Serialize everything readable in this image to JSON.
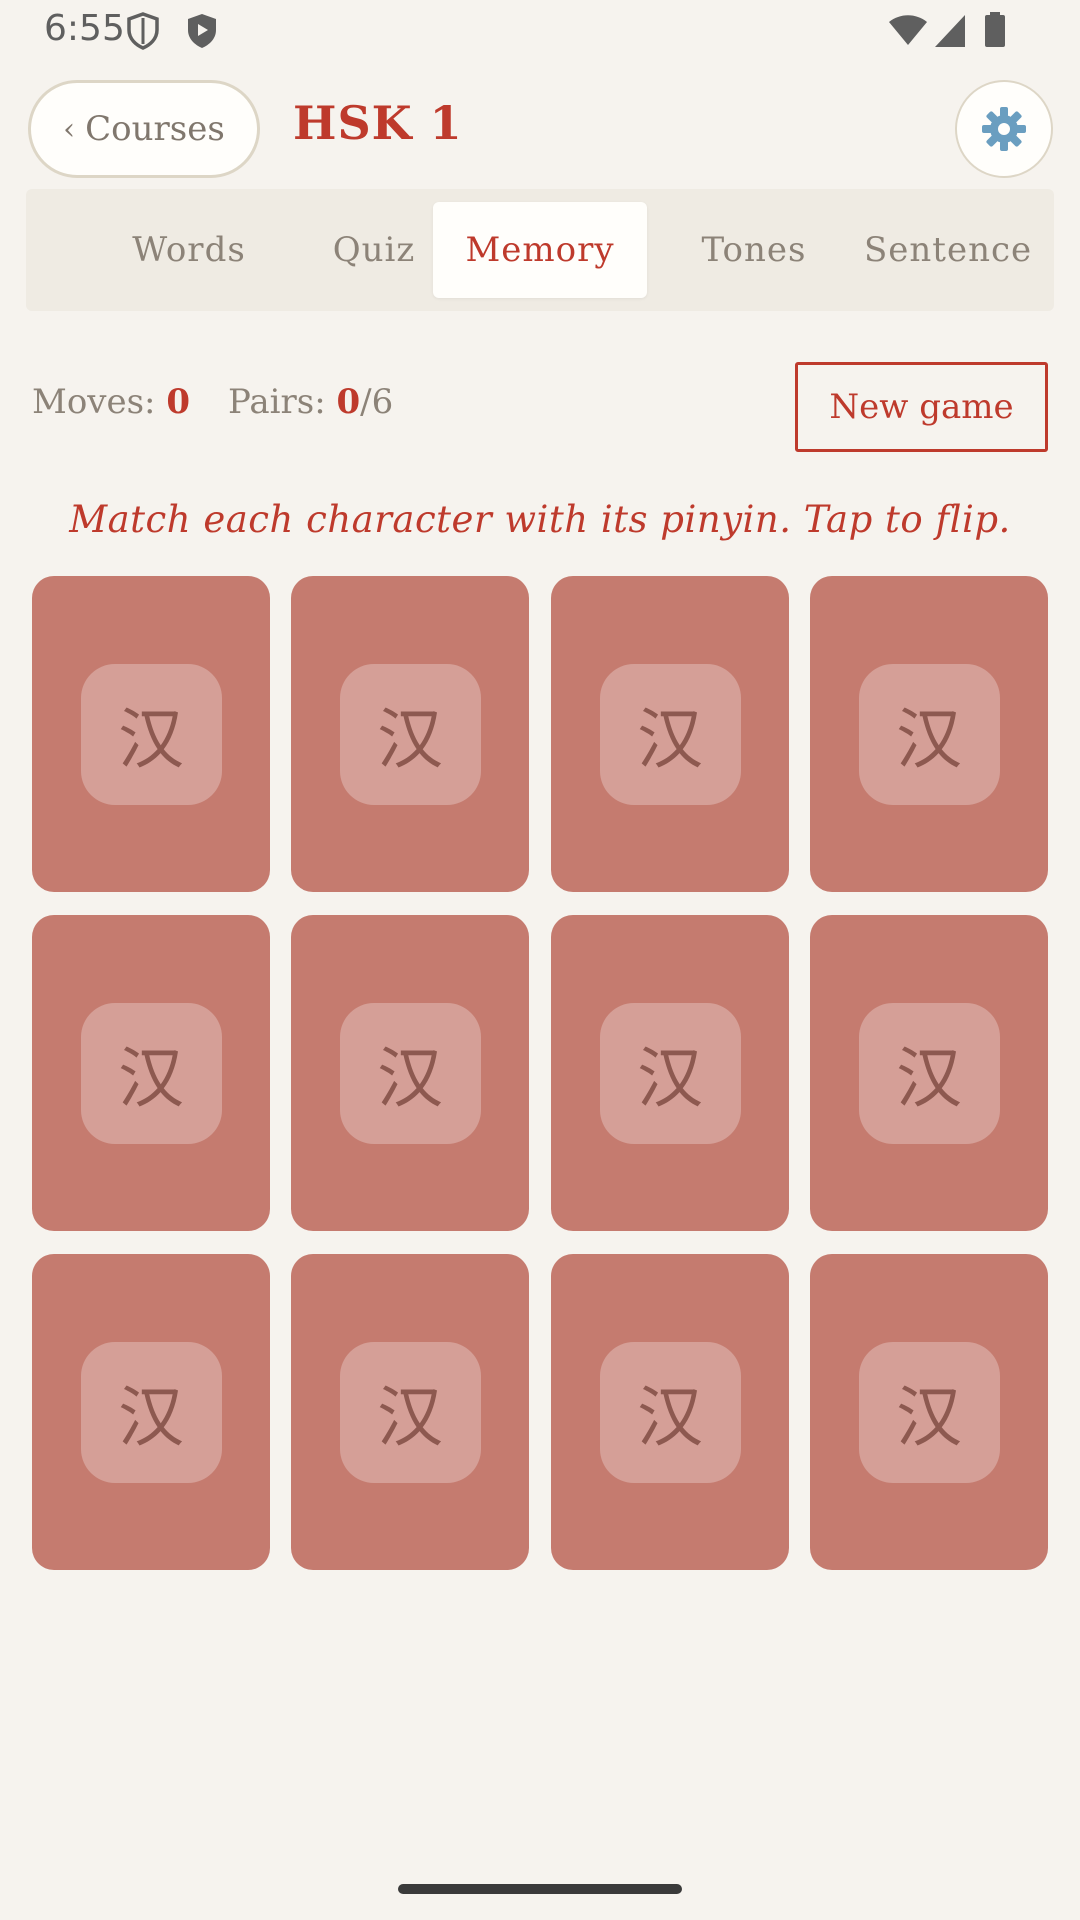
{
  "status_bar": {
    "time": "6:55"
  },
  "header": {
    "back_label": "Courses",
    "back_chevron": "‹",
    "title": "HSK 1",
    "settings_icon": "⚙️"
  },
  "tabs": [
    {
      "label": "Words"
    },
    {
      "label": "Quiz"
    },
    {
      "label": "Memory"
    },
    {
      "label": "Tones"
    },
    {
      "label": "Sentence"
    }
  ],
  "active_tab": "Memory",
  "stats": {
    "moves_label": "Moves:",
    "moves": "0",
    "pairs_label": "Pairs:",
    "pairs": "0",
    "pairs_total": "/6"
  },
  "new_game_label": "New game",
  "instruction": "Match each character with its pinyin. Tap to flip.",
  "cards": [
    {
      "face": "汉"
    },
    {
      "face": "汉"
    },
    {
      "face": "汉"
    },
    {
      "face": "汉"
    },
    {
      "face": "汉"
    },
    {
      "face": "汉"
    },
    {
      "face": "汉"
    },
    {
      "face": "汉"
    },
    {
      "face": "汉"
    },
    {
      "face": "汉"
    },
    {
      "face": "汉"
    },
    {
      "face": "汉"
    }
  ],
  "colors": {
    "accent": "#be3a2c",
    "card": "#c57b6f",
    "background": "#f6f3ee"
  }
}
